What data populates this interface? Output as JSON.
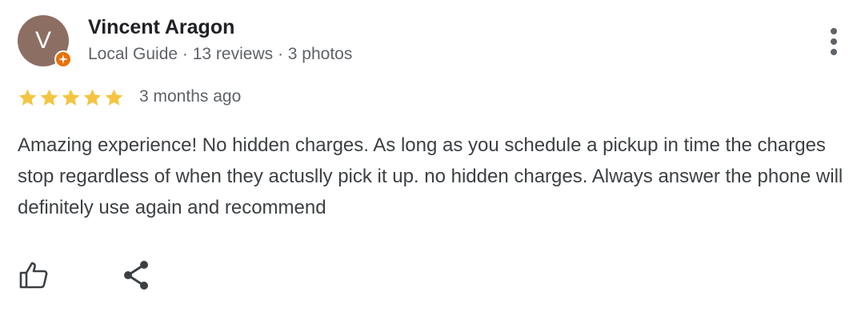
{
  "reviewer": {
    "avatar_letter": "V",
    "avatar_color": "#8d6e63",
    "badge_color": "#e8710a",
    "name": "Vincent Aragon",
    "meta": "Local Guide · 13 reviews · 3 photos"
  },
  "review": {
    "rating": 5,
    "max_rating": 5,
    "star_color": "#f4c542",
    "time_ago": "3 months ago",
    "text": "Amazing experience! No hidden charges. As long as you schedule a pickup in time the charges stop regardless of when they actuslly pick it up. no hidden charges. Always answer the phone will definitely use again and recommend"
  },
  "actions": {
    "icons": [
      "more-vert-icon",
      "thumb-up-icon",
      "share-icon"
    ]
  }
}
